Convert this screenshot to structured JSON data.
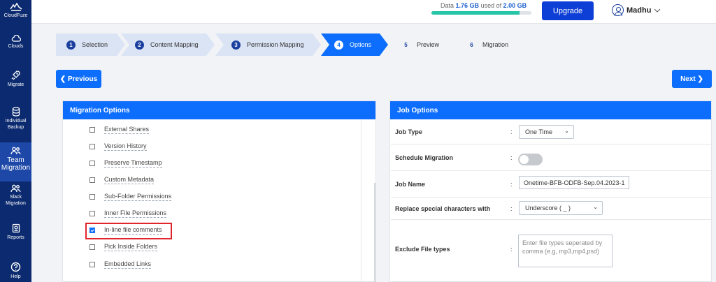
{
  "sidebar": {
    "brand": "CloudFuze",
    "items": [
      {
        "label": "Clouds",
        "icon": "cloud-icon"
      },
      {
        "label": "Migrate",
        "icon": "rocket-icon"
      },
      {
        "label": "Individual Backup",
        "icon": "database-icon"
      },
      {
        "label": "Team Migration",
        "icon": "team-icon"
      },
      {
        "label": "Slack Migration",
        "icon": "slack-team-icon"
      },
      {
        "label": "Reports",
        "icon": "report-icon"
      },
      {
        "label": "Help",
        "icon": "help-icon"
      }
    ]
  },
  "header": {
    "data_prefix": "Data",
    "data_used": "1.76 GB",
    "data_mid": "used of",
    "data_total": "2.00 GB",
    "usage_fraction": 0.88,
    "upgrade_label": "Upgrade",
    "user_name": "Madhu"
  },
  "stepper": [
    {
      "num": "1",
      "label": "Selection"
    },
    {
      "num": "2",
      "label": "Content Mapping"
    },
    {
      "num": "3",
      "label": "Permission Mapping"
    },
    {
      "num": "4",
      "label": "Options"
    },
    {
      "num": "5",
      "label": "Preview"
    },
    {
      "num": "6",
      "label": "Migration"
    }
  ],
  "nav": {
    "previous": "Previous",
    "next": "Next"
  },
  "migration_options": {
    "title": "Migration Options",
    "options": [
      {
        "label": "External Shares",
        "checked": false
      },
      {
        "label": "Version History",
        "checked": false
      },
      {
        "label": "Preserve Timestamp",
        "checked": false
      },
      {
        "label": "Custom Metadata",
        "checked": false
      },
      {
        "label": "Sub-Folder Permissions",
        "checked": false
      },
      {
        "label": "Inner File Permissions",
        "checked": false
      },
      {
        "label": "In-line file comments",
        "checked": true
      },
      {
        "label": "Pick Inside Folders",
        "checked": false
      },
      {
        "label": "Embedded Links",
        "checked": false
      }
    ]
  },
  "job_options": {
    "title": "Job Options",
    "job_type_label": "Job Type",
    "job_type_value": "One Time",
    "schedule_label": "Schedule Migration",
    "schedule_enabled": false,
    "job_name_label": "Job Name",
    "job_name_value": "Onetime-BFB-ODFB-Sep.04.2023-1",
    "replace_label": "Replace special characters with",
    "replace_value": "Underscore ( _ )",
    "exclude_label": "Exclude File types",
    "exclude_placeholder": "Enter file types seperated by comma (e.g, mp3,mp4,psd)"
  },
  "colors": {
    "sidebar": "#0b2a6f",
    "accent": "#0d6efd",
    "highlight": "#e0262c"
  }
}
